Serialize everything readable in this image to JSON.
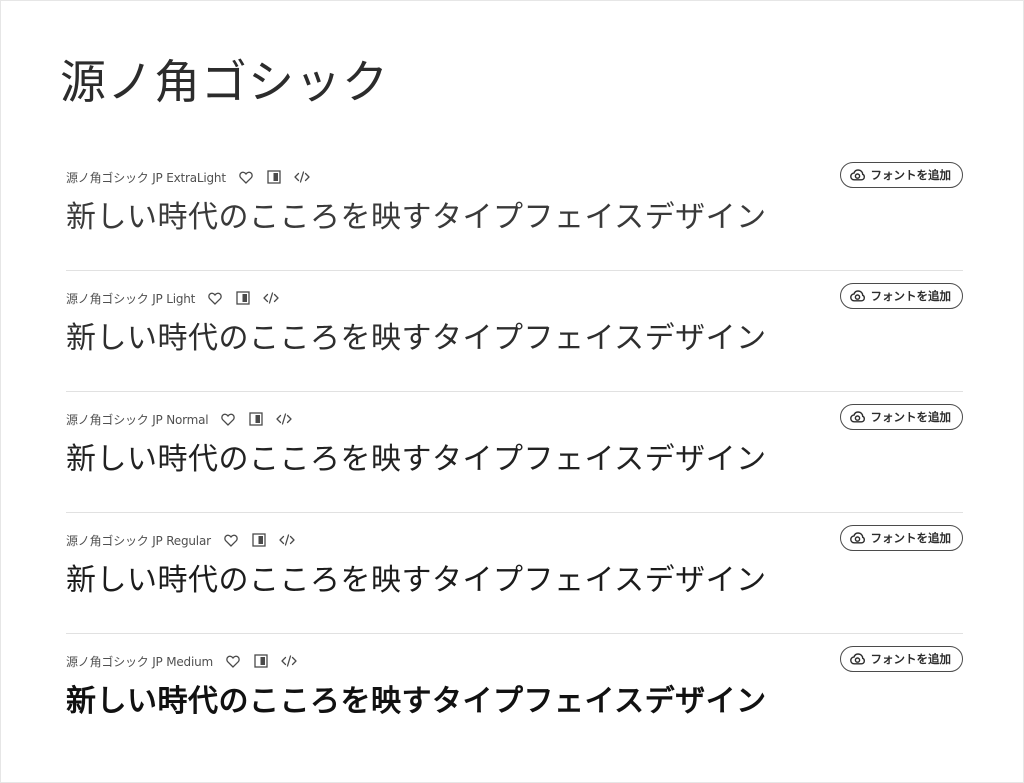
{
  "page": {
    "title": "源ノ角ゴシック"
  },
  "add_button_label": "フォントを追加",
  "icons": {
    "favorite": "heart-icon",
    "sample": "preview-icon",
    "embed": "code-icon",
    "add": "creative-cloud-icon"
  },
  "families": [
    {
      "name": "源ノ角ゴシック JP ExtraLight",
      "sample": "新しい時代のこころを映すタイプフェイスデザイン",
      "weight": "extralight"
    },
    {
      "name": "源ノ角ゴシック JP Light",
      "sample": "新しい時代のこころを映すタイプフェイスデザイン",
      "weight": "light"
    },
    {
      "name": "源ノ角ゴシック JP Normal",
      "sample": "新しい時代のこころを映すタイプフェイスデザイン",
      "weight": "normal"
    },
    {
      "name": "源ノ角ゴシック JP Regular",
      "sample": "新しい時代のこころを映すタイプフェイスデザイン",
      "weight": "regular"
    },
    {
      "name": "源ノ角ゴシック JP Medium",
      "sample": "新しい時代のこころを映すタイプフェイスデザイン",
      "weight": "medium"
    }
  ]
}
